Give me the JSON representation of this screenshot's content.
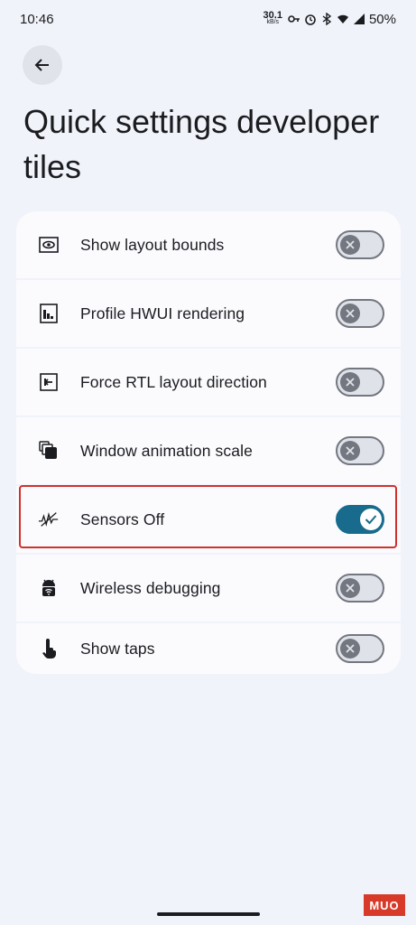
{
  "status_bar": {
    "time": "10:46",
    "speed_value": "30.1",
    "speed_unit": "kB/s",
    "battery": "50%"
  },
  "header": {
    "title": "Quick settings developer tiles"
  },
  "tiles": [
    {
      "label": "Show layout bounds",
      "icon": "layout-bounds-icon",
      "enabled": false
    },
    {
      "label": "Profile HWUI rendering",
      "icon": "hwui-profile-icon",
      "enabled": false
    },
    {
      "label": "Force RTL layout direction",
      "icon": "rtl-direction-icon",
      "enabled": false
    },
    {
      "label": "Window animation scale",
      "icon": "animation-scale-icon",
      "enabled": false
    },
    {
      "label": "Sensors Off",
      "icon": "sensors-off-icon",
      "enabled": true
    },
    {
      "label": "Wireless debugging",
      "icon": "android-wifi-icon",
      "enabled": false
    },
    {
      "label": "Show taps",
      "icon": "tap-icon",
      "enabled": false
    }
  ],
  "colors": {
    "background": "#f1f3fa",
    "switch_on": "#186b8c",
    "highlight": "#d0312d"
  },
  "watermark": "MUO"
}
